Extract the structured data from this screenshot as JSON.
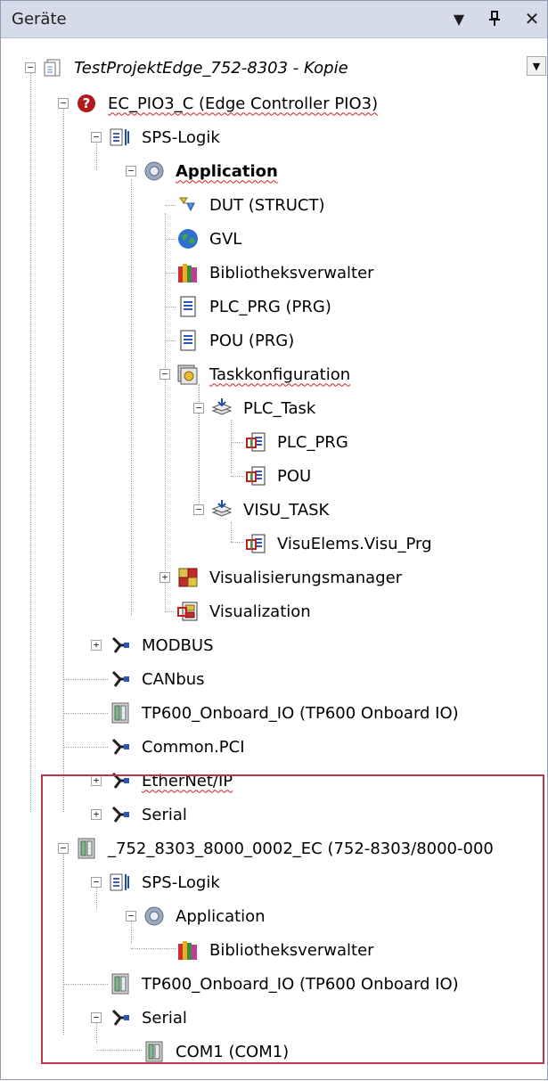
{
  "panel": {
    "title": "Geräte",
    "dropdown_glyph": "▼",
    "pin_glyph": "ᵽ",
    "close_glyph": "✕"
  },
  "colors": {
    "titlebar_bg": "#d6dbe9",
    "selection_frame": "#c0334a",
    "spell_squiggle": "#d01d1d"
  },
  "tree": [
    {
      "label": "TestProjektEdge_752-8303 - Kopie",
      "icon": "project-icon"
    },
    {
      "label": "EC_PIO3_C (Edge Controller PIO3)",
      "icon": "question-device-icon"
    },
    {
      "label": "SPS-Logik",
      "icon": "plc-logic-icon"
    },
    {
      "label": "Application",
      "icon": "application-gear-icon"
    },
    {
      "label": "DUT (STRUCT)",
      "icon": "dut-icon"
    },
    {
      "label": "GVL",
      "icon": "globe-icon"
    },
    {
      "label": "Bibliotheksverwalter",
      "icon": "library-books-icon"
    },
    {
      "label": "PLC_PRG (PRG)",
      "icon": "document-icon"
    },
    {
      "label": "POU (PRG)",
      "icon": "document-icon"
    },
    {
      "label": "Taskkonfiguration",
      "icon": "task-config-icon"
    },
    {
      "label": "PLC_Task",
      "icon": "task-icon"
    },
    {
      "label": "PLC_PRG",
      "icon": "program-call-icon"
    },
    {
      "label": "POU",
      "icon": "program-call-icon"
    },
    {
      "label": "VISU_TASK",
      "icon": "task-icon"
    },
    {
      "label": "VisuElems.Visu_Prg",
      "icon": "program-call-icon"
    },
    {
      "label": "Visualisierungsmanager",
      "icon": "visu-manager-icon"
    },
    {
      "label": "Visualization",
      "icon": "visualization-icon"
    },
    {
      "label": "MODBUS",
      "icon": "fieldbus-icon"
    },
    {
      "label": "CANbus",
      "icon": "fieldbus-icon"
    },
    {
      "label": "TP600_Onboard_IO (TP600 Onboard IO)",
      "icon": "io-module-icon"
    },
    {
      "label": "Common.PCI",
      "icon": "fieldbus-icon"
    },
    {
      "label": "EtherNet/IP",
      "icon": "fieldbus-icon"
    },
    {
      "label": "Serial",
      "icon": "fieldbus-icon"
    },
    {
      "label": "_752_8303_8000_0002_EC (752-8303/8000-000",
      "icon": "io-module-icon"
    },
    {
      "label": "SPS-Logik",
      "icon": "plc-logic-icon"
    },
    {
      "label": "Application",
      "icon": "application-gear-icon"
    },
    {
      "label": "Bibliotheksverwalter",
      "icon": "library-books-icon"
    },
    {
      "label": "TP600_Onboard_IO (TP600 Onboard IO)",
      "icon": "io-module-icon"
    },
    {
      "label": "Serial",
      "icon": "fieldbus-icon"
    },
    {
      "label": "COM1 (COM1)",
      "icon": "io-module-icon"
    }
  ]
}
